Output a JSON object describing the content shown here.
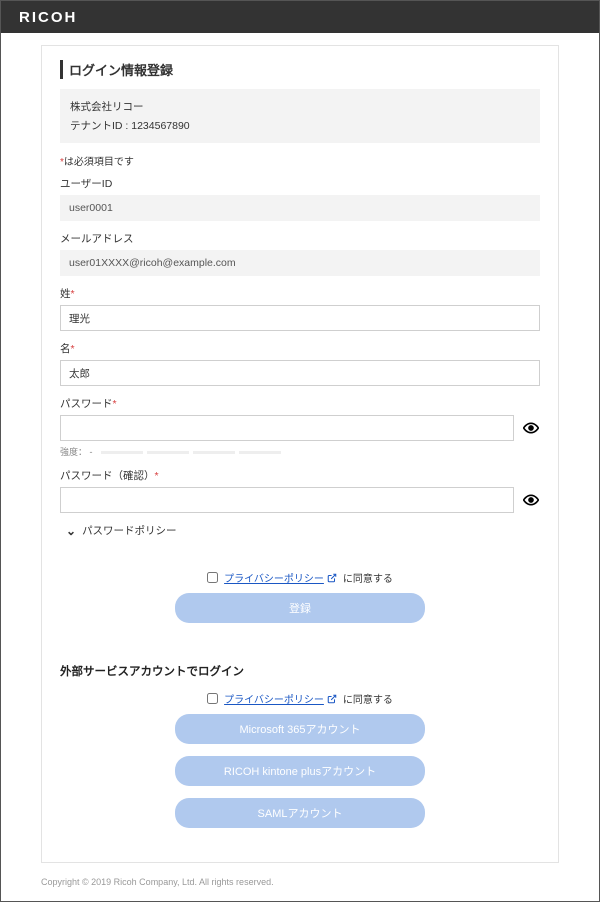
{
  "brand": "RICOH",
  "page_title": "ログイン情報登録",
  "tenant": {
    "company": "株式会社リコー",
    "id_label": "テナントID : 1234567890"
  },
  "required_note_prefix": "*",
  "required_note_text": "は必須項目です",
  "fields": {
    "user_id": {
      "label": "ユーザーID",
      "value": "user0001"
    },
    "email": {
      "label": "メールアドレス",
      "value": "user01XXXX@ricoh@example.com"
    },
    "last_name": {
      "label": "姓",
      "value": "理光"
    },
    "first_name": {
      "label": "名",
      "value": "太郎"
    },
    "password": {
      "label": "パスワード",
      "value": ""
    },
    "password_confirm": {
      "label": "パスワード（確認）",
      "value": ""
    }
  },
  "strength": {
    "label": "強度：",
    "value": "-"
  },
  "policy_toggle": "パスワードポリシー",
  "privacy": {
    "link": "プライバシーポリシー",
    "suffix": "に同意する"
  },
  "buttons": {
    "register": "登録",
    "microsoft": "Microsoft 365アカウント",
    "kintone": "RICOH kintone plusアカウント",
    "saml": "SAMLアカウント"
  },
  "external_title": "外部サービスアカウントでログイン",
  "footer": "Copyright © 2019 Ricoh Company, Ltd. All rights reserved."
}
